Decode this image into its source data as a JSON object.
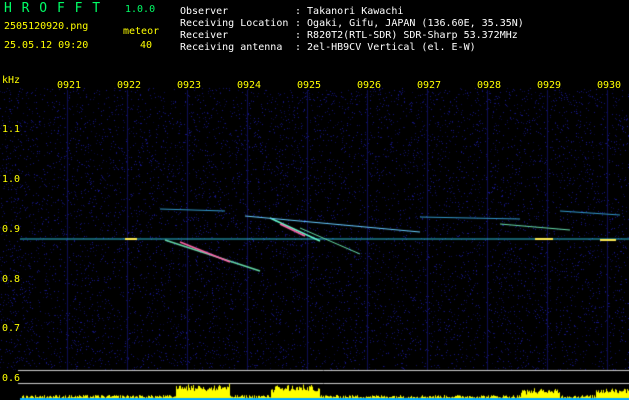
{
  "app": {
    "logo": "H R O F F T",
    "version": "1.0.0",
    "filename": "2505120920.png",
    "datetime": "25.05.12 09:20",
    "counter_label": "meteor",
    "counter_value": "40"
  },
  "info": {
    "rows": [
      {
        "label": "Observer",
        "value": ": Takanori Kawachi"
      },
      {
        "label": "Receiving Location",
        "value": ": Ogaki, Gifu, JAPAN (136.60E, 35.35N)"
      },
      {
        "label": "Receiver",
        "value": ": R820T2(RTL-SDR) SDR-Sharp 53.372MHz"
      },
      {
        "label": "Receiving antenna",
        "value": ": 2el-HB9CV Vertical (el. E-W)"
      }
    ]
  },
  "axis": {
    "y_unit": "kHz",
    "y_ticks": [
      "1.1",
      "1.0",
      "0.9",
      "0.8",
      "0.7",
      "0.6"
    ],
    "x_ticks": [
      "0921",
      "0922",
      "0923",
      "0924",
      "0925",
      "0926",
      "0927",
      "0928",
      "0929",
      "0930"
    ]
  },
  "colors": {
    "background": "#000000",
    "noise": "#1a1aa0",
    "carrier": "#33ddff",
    "meteor_hot": "#ff66aa",
    "signal_level": "#ffff00",
    "labels": "#ffff00",
    "text": "#ffffff"
  }
}
